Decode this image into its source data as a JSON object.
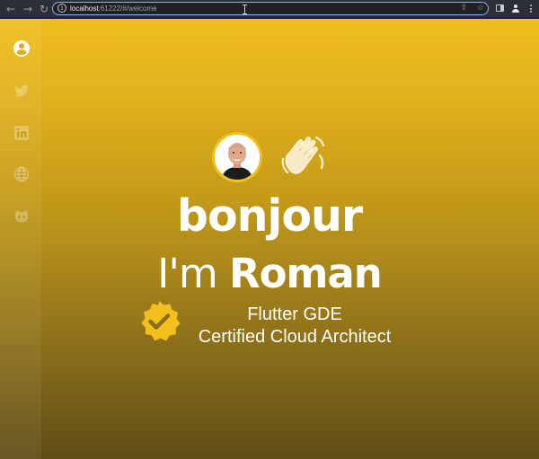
{
  "browser": {
    "url_host": "localhost",
    "url_rest": ":61222/#/welcome",
    "icons": [
      "back-arrow-icon",
      "forward-arrow-icon",
      "reload-icon",
      "site-info-icon",
      "share-icon",
      "star-icon",
      "side-panel-icon",
      "profile-icon",
      "menu-kebab-icon"
    ]
  },
  "sidebar": {
    "items": [
      {
        "icon": "account-circle-icon",
        "active": true
      },
      {
        "icon": "twitter-icon",
        "active": false
      },
      {
        "icon": "linkedin-icon",
        "active": false
      },
      {
        "icon": "globe-icon",
        "active": false
      },
      {
        "icon": "github-icon",
        "active": false
      }
    ]
  },
  "hero": {
    "greeting": "bonjour",
    "intro_prefix": "I'm ",
    "name": "Roman",
    "title_line_1": "Flutter GDE",
    "title_line_2": "Certified Cloud Architect",
    "icons": [
      "avatar-photo",
      "waving-hand-icon",
      "verified-badge-icon"
    ]
  },
  "colors": {
    "accent_yellow": "#f2c01c",
    "gradient_top": "#efbe1e",
    "gradient_bottom": "#5f4d16",
    "text": "#ffffff"
  }
}
